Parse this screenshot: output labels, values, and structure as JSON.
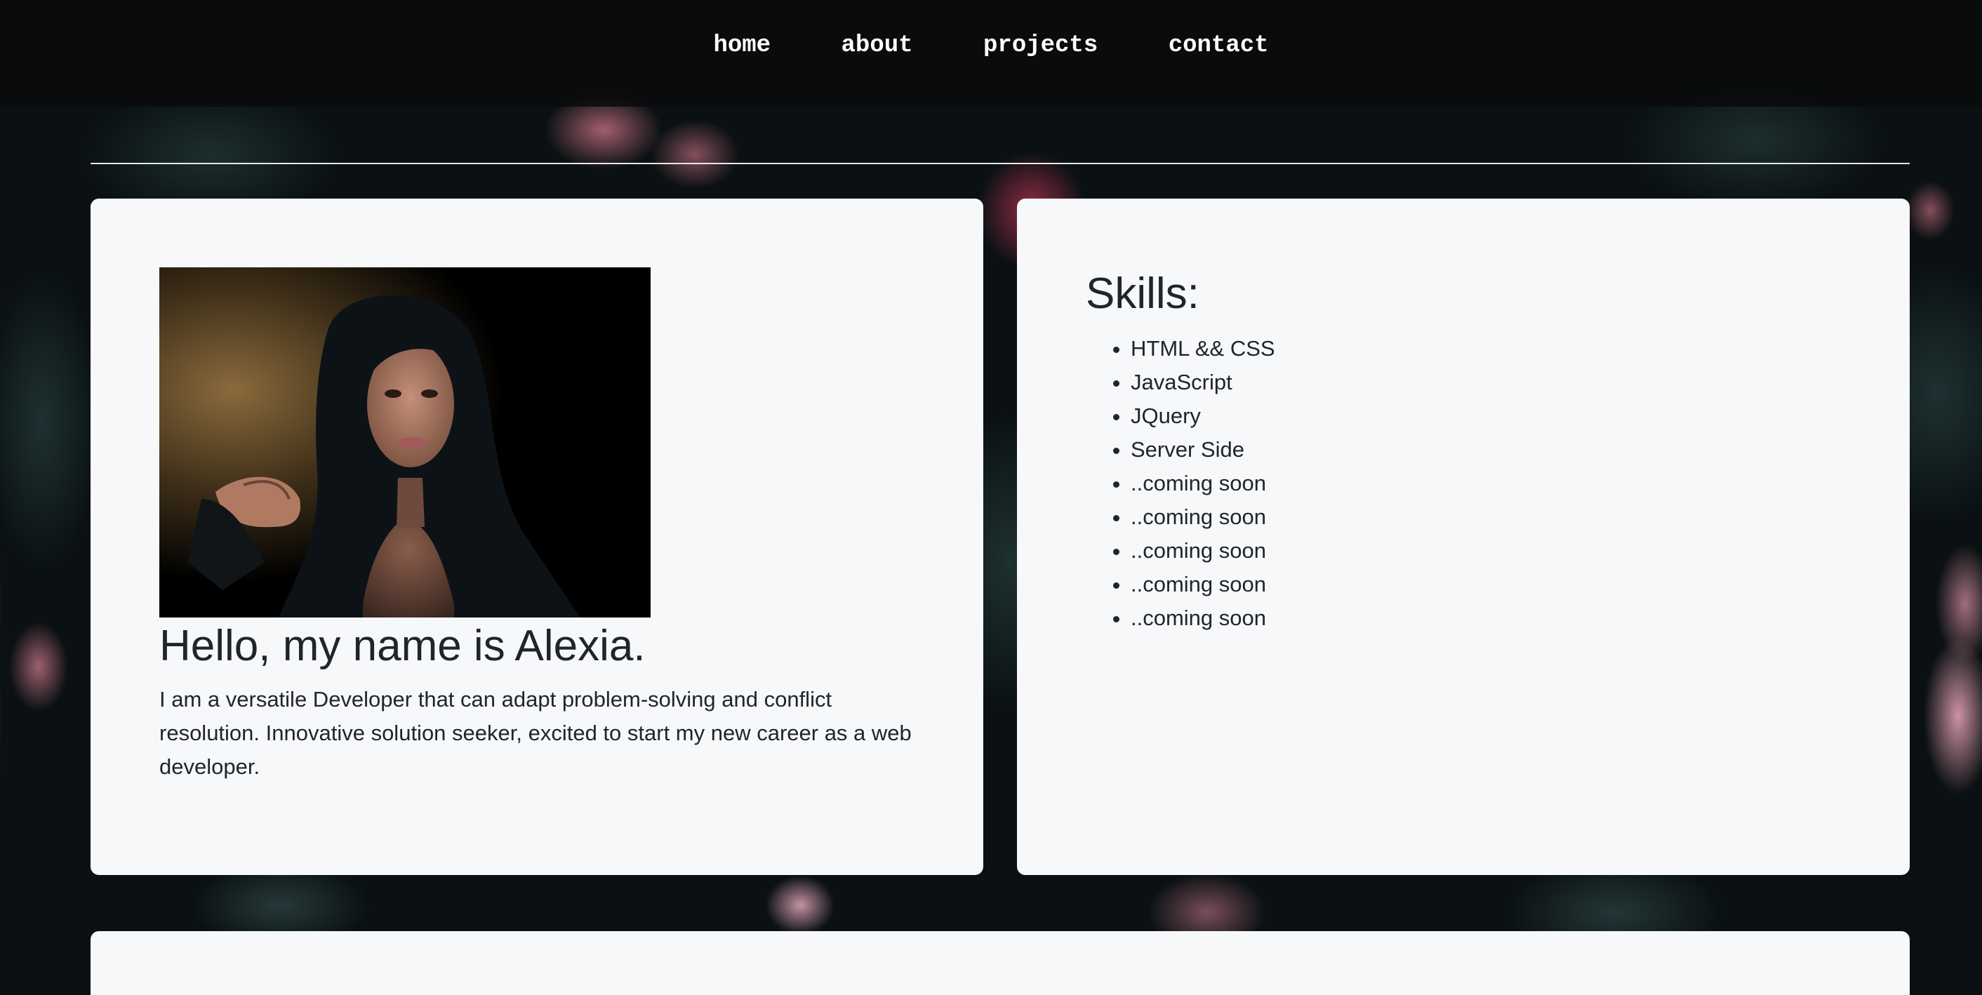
{
  "nav": {
    "items": [
      {
        "label": "home"
      },
      {
        "label": "about"
      },
      {
        "label": "projects"
      },
      {
        "label": "contact"
      }
    ]
  },
  "intro": {
    "heading": "Hello, my name is Alexia.",
    "text": "I am a versatile Developer that can adapt problem-solving and conflict resolution. Innovative solution seeker, excited to start my new career as a web developer."
  },
  "skills": {
    "heading": "Skills:",
    "items": [
      "HTML && CSS",
      "JavaScript",
      "JQuery",
      "Server Side",
      "..coming soon",
      "..coming soon",
      "..coming soon",
      "..coming soon",
      "..coming soon"
    ]
  },
  "colors": {
    "card_background": "#f7f8fa",
    "text": "#212529",
    "nav_text": "#ffffff",
    "nav_background": "#080a0b"
  }
}
